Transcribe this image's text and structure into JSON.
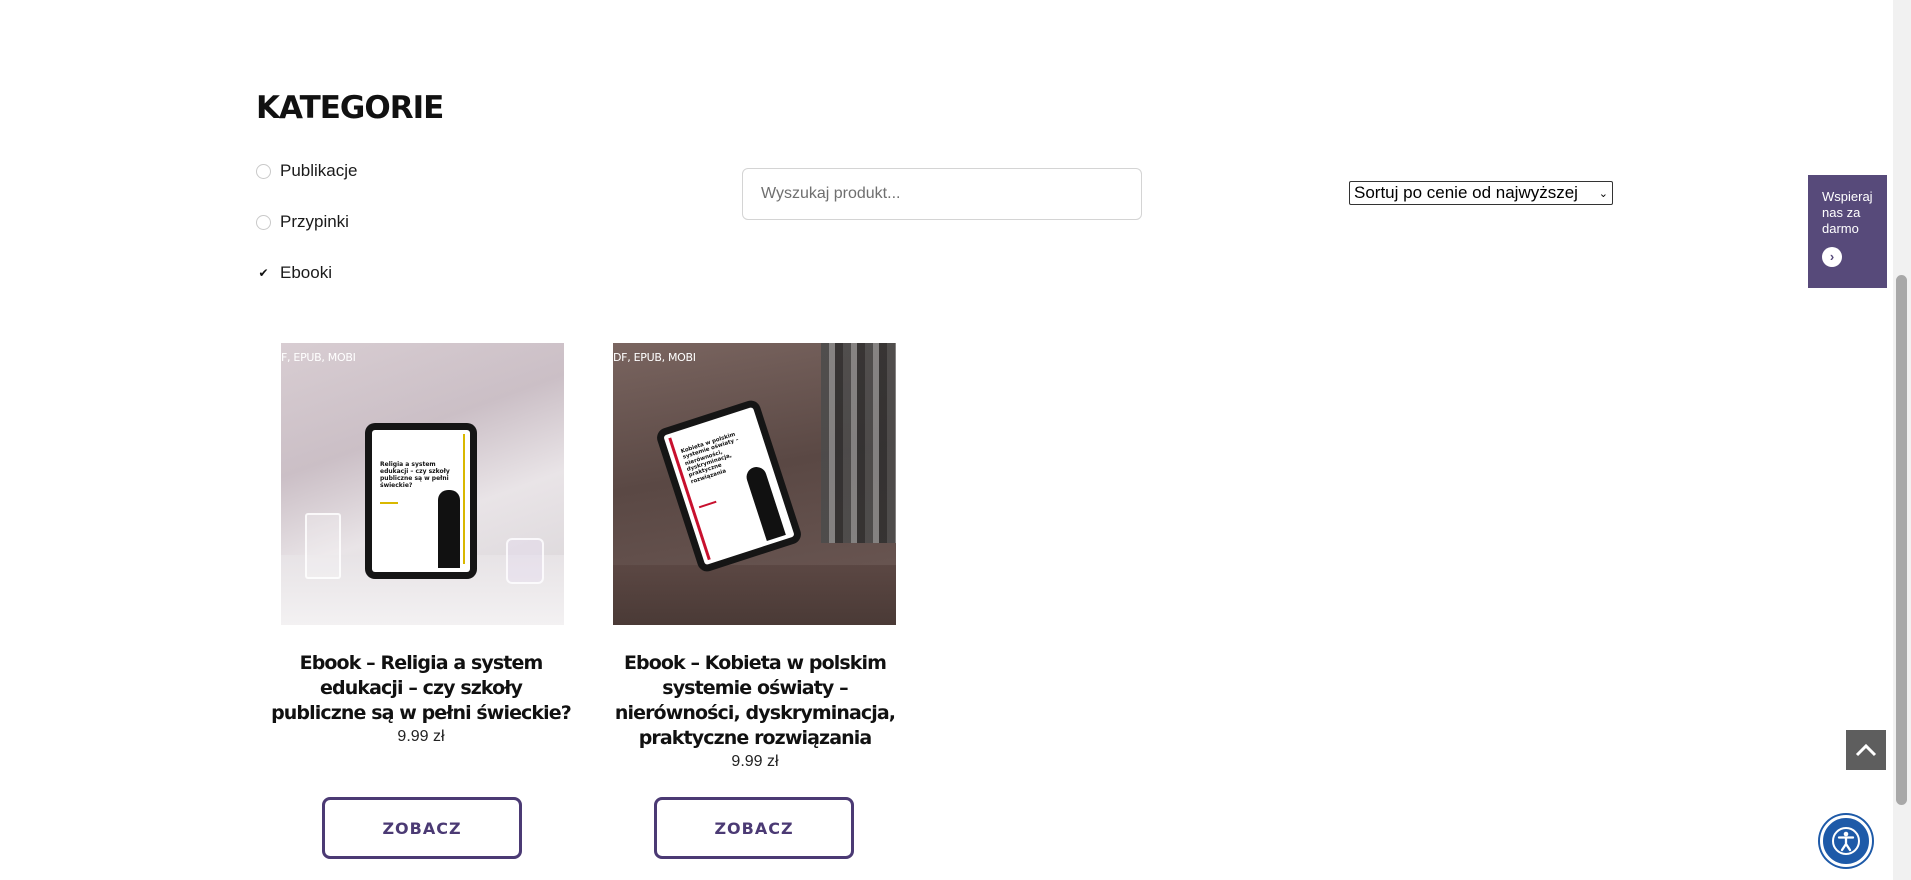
{
  "categories": {
    "heading": "KATEGORIE",
    "items": [
      {
        "label": "Publikacje",
        "checked": false
      },
      {
        "label": "Przypinki",
        "checked": false
      },
      {
        "label": "Ebooki",
        "checked": true
      }
    ]
  },
  "search": {
    "placeholder": "Wyszukaj produkt..."
  },
  "sort": {
    "selected": "Sortuj po cenie od najwyższej"
  },
  "products": [
    {
      "image_label": "F, EPUB, MOBI",
      "cover_title": "Religia a system edukacji – czy szkoły publiczne są w pełni świeckie?",
      "title": "Ebook – Religia a system edukacji – czy szkoły publiczne są w pełni świeckie?",
      "price": "9.99 zł",
      "button": "ZOBACZ"
    },
    {
      "image_label": "DF, EPUB, MOBI",
      "cover_title": "Kobieta w polskim systemie oświaty – nierówności, dyskryminacja, praktyczne rozwiązania",
      "title": "Ebook – Kobieta w polskim systemie oświaty – nierówności, dyskryminacja, praktyczne rozwiązania",
      "price": "9.99 zł",
      "button": "ZOBACZ"
    }
  ],
  "support": {
    "text": "Wspieraj nas za darmo"
  },
  "colors": {
    "accent": "#4b3a74",
    "support_bg": "#574a7a",
    "a11y_bg": "#1e5aa8"
  }
}
